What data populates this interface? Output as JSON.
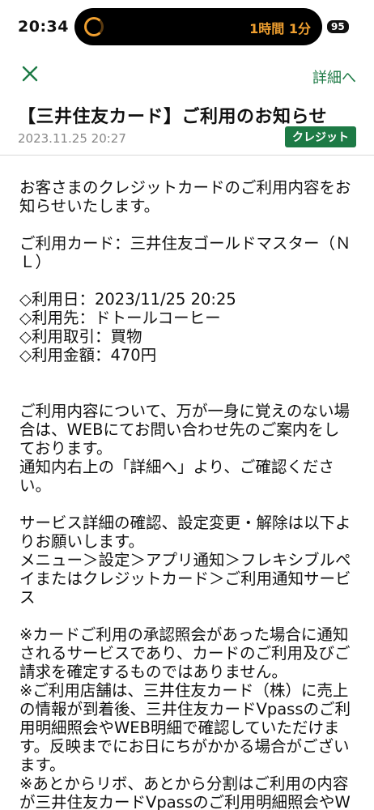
{
  "status_bar": {
    "time": "20:34",
    "timer_text": "1時間 1分",
    "battery": "95"
  },
  "nav": {
    "close_icon": "close-icon",
    "detail_link": "詳細へ"
  },
  "message": {
    "title": "【三井住友カード】ご利用のお知らせ",
    "date": "2023.11.25 20:27",
    "tag": "クレジット",
    "body": "お客さまのクレジットカードのご利用内容をお知らせいたします。\n\nご利用カード：三井住友ゴールドマスター（ＮＬ）\n\n◇利用日：2023/11/25 20:25\n◇利用先：ドトールコーヒー\n◇利用取引：買物\n◇利用金額：470円\n\n\nご利用内容について、万が一身に覚えのない場合は、WEBにてお問い合わせ先のご案内をしております。\n通知内右上の「詳細へ」より、ご確認ください。\n\nサービス詳細の確認、設定変更・解除は以下よりお願いします。\nメニュー＞設定＞アプリ通知＞フレキシブルペイまたはクレジットカード＞ご利用通知サービス\n\n※カードご利用の承認照会があった場合に通知されるサービスであり、カードのご利用及びご請求を確定するものではありません。\n※ご利用店舗は、三井住友カード（株）に売上の情報が到着後、三井住友カードVpassのご利用明細照会やWEB明細で確認していただけます。反映までにお日にちがかかる場合がございます。\n※あとからリボ、あとから分割はご利用の内容が三井住友カードVpassのご利用明細照会やWEB明細に反映後、お申込い"
  },
  "colors": {
    "accent": "#1d7a45",
    "timer": "#f0a030"
  }
}
